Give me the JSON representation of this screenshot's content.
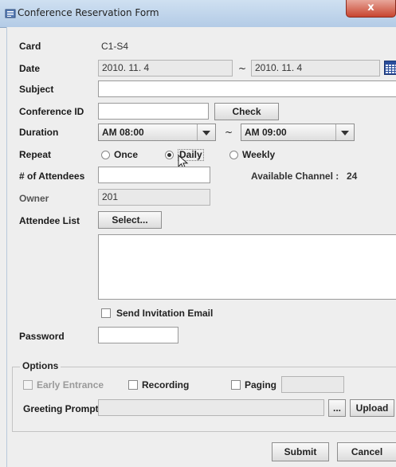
{
  "window": {
    "title": "Conference Reservation Form",
    "close_label": "x"
  },
  "form": {
    "card_label": "Card",
    "card_value": "C1-S4",
    "date_label": "Date",
    "date_start": "2010. 11. 4",
    "date_sep": "~",
    "date_end": "2010. 11. 4",
    "subject_label": "Subject",
    "subject_value": "",
    "conference_id_label": "Conference ID",
    "conference_id_value": "",
    "check_button": "Check",
    "duration_label": "Duration",
    "duration_start": "AM 08:00",
    "duration_sep": "~",
    "duration_end": "AM 09:00",
    "repeat_label": "Repeat",
    "repeat_options": [
      "Once",
      "Daily",
      "Weekly"
    ],
    "repeat_selected": "Daily",
    "attendees_label": "# of Attendees",
    "attendees_value": "",
    "available_channel_label": "Available Channel :",
    "available_channel_value": "24",
    "owner_label": "Owner",
    "owner_value": "201",
    "attendee_list_label": "Attendee List",
    "select_button": "Select...",
    "send_invitation_label": "Send Invitation Email",
    "password_label": "Password",
    "password_value": ""
  },
  "options": {
    "title": "Options",
    "early_entrance": "Early Entrance",
    "recording": "Recording",
    "paging": "Paging",
    "greeting_prompt_label": "Greeting Prompt",
    "greeting_prompt_value": "",
    "browse_button": "...",
    "upload_button": "Upload"
  },
  "actions": {
    "submit": "Submit",
    "cancel": "Cancel"
  }
}
